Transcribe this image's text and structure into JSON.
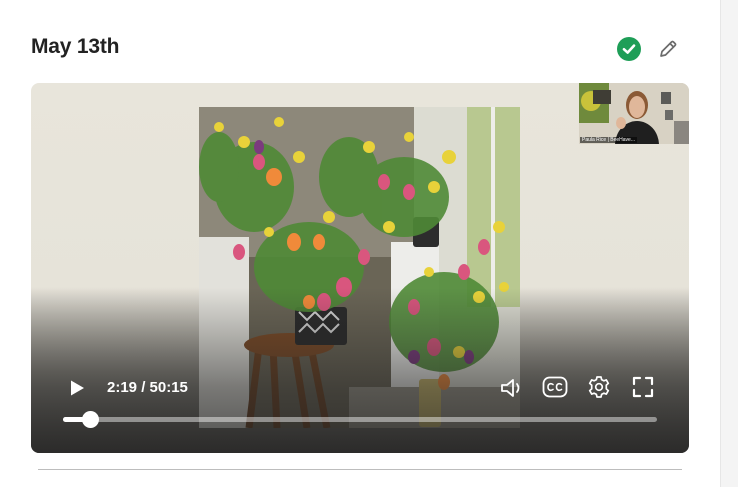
{
  "lesson": {
    "title": "May 13th",
    "completed_icon": "check-circle-icon",
    "edit_icon": "pencil-icon"
  },
  "video": {
    "current_time": "2:19",
    "separator": "/",
    "duration": "50:15",
    "time_display": "2:19 / 50:15",
    "progress": 0.046,
    "pip_caption": "Paula Rice | BeeHave...",
    "icons": [
      "play-icon",
      "volume-icon",
      "captions-icon",
      "settings-icon",
      "fullscreen-icon"
    ]
  },
  "colors": {
    "accent_check": "#1e9e57",
    "backdrop": "#e8e5db"
  }
}
